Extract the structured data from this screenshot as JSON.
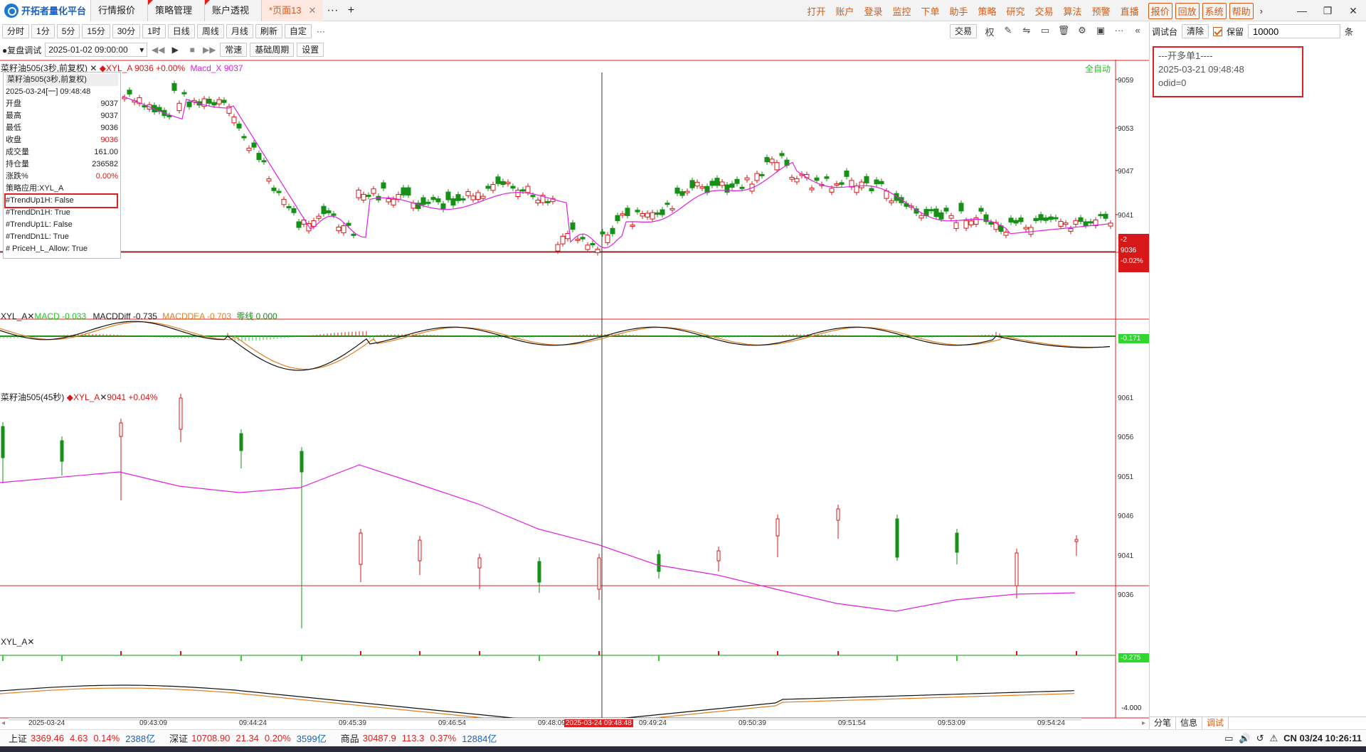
{
  "app": {
    "logo_text": "开拓者量化平台"
  },
  "tabs": [
    {
      "label": "行情报价",
      "flag": false,
      "active": false
    },
    {
      "label": "策略管理",
      "flag": true,
      "active": false
    },
    {
      "label": "账户透视",
      "flag": true,
      "active": false
    },
    {
      "label": "*页面13",
      "flag": false,
      "active": true,
      "close": "✕"
    }
  ],
  "tab_more": "···",
  "tab_add": "+",
  "menu": {
    "items": [
      "打开",
      "账户",
      "登录",
      "监控",
      "下单",
      "助手",
      "策略",
      "研究",
      "交易",
      "算法",
      "预警",
      "直播"
    ],
    "boxed": [
      "报价",
      "回放",
      "系统",
      "帮助"
    ],
    "arrow": "›"
  },
  "window_controls": {
    "minimize": "—",
    "restore": "❐",
    "close": "✕"
  },
  "toolbar1": {
    "periods": [
      "分时",
      "1分",
      "5分",
      "15分",
      "30分",
      "1时",
      "日线",
      "周线",
      "月线",
      "刷新",
      "自定"
    ],
    "more": "···",
    "trade_button": "交易",
    "right_icons": [
      "权",
      "✎",
      "⇋",
      "▭",
      "🗑",
      "⚙",
      "▣",
      "···",
      "«"
    ]
  },
  "toolbar2": {
    "replay_label": "●复盘调试",
    "date_value": "2025-01-02 09:00:00",
    "date_arrow": "▾",
    "controls": [
      "◀◀",
      "▶",
      "■",
      "▶▶"
    ],
    "buttons": [
      "常速",
      "基础周期",
      "设置"
    ]
  },
  "panel1": {
    "title": "菜籽油505(3秒,前复权)",
    "close": "✕",
    "indicator": "◆XYL_A",
    "price": "9036",
    "change": "+0.00%",
    "macd_label": "Macd_X 9037",
    "auto_label": "全自动",
    "price_tag": [
      "-2",
      "9036",
      "-0.02%"
    ],
    "yticks": [
      "9059",
      "9053",
      "9047",
      "9041"
    ]
  },
  "infobox": {
    "title": "菜籽油505(3秒,前复权)",
    "datetime": "2025-03-24[一] 09:48:48",
    "rows": [
      {
        "k": "开盘",
        "v": "9037"
      },
      {
        "k": "最高",
        "v": "9037"
      },
      {
        "k": "最低",
        "v": "9036"
      },
      {
        "k": "收盘",
        "v": "9036"
      },
      {
        "k": "成交量",
        "v": "161.00"
      },
      {
        "k": "持仓量",
        "v": "236582"
      },
      {
        "k": "涨跌%",
        "v": "0.00%"
      }
    ],
    "strategy": "策略应用:XYL_A",
    "flags": [
      "#TrendUp1H: False",
      "#TrendDn1H: True",
      "#TrendUp1L: False",
      "#TrendDn1L: True",
      "# PriceH_L_Allow: True"
    ]
  },
  "panel2": {
    "name": "XYL_A",
    "close": "✕",
    "macd": "MACD -0.033",
    "diff": "MACDDiff -0.735",
    "dea": "MACDDEA -0.703",
    "zero": "零线 0.000",
    "tag": "-0.171"
  },
  "panel3": {
    "title": "菜籽油505(45秒)",
    "indicator": "◆XYL_A",
    "close": "✕",
    "price": "9041",
    "change": "+0.04%",
    "yticks": [
      "9061",
      "9056",
      "9051",
      "9046",
      "9041",
      "9036"
    ]
  },
  "panel4": {
    "name": "XYL_A",
    "close": "✕",
    "tag": "-0.275",
    "ytick": "-4.000"
  },
  "xaxis": {
    "labels": [
      "2025-03-24",
      "09:43:09",
      "09:44:24",
      "09:45:39",
      "09:46:54",
      "09:48:09",
      "09:49:24",
      "09:50:39",
      "09:51:54",
      "09:53:09",
      "09:54:24"
    ],
    "cursor_label": "2025-03-24 09:48:48",
    "arrow_left": "◂",
    "arrow_right": "▸"
  },
  "right_panel": {
    "debug_label": "调试台",
    "clear_button": "清除",
    "keep_label": "保留",
    "keep_value": "10000",
    "edge_label": "条",
    "log": [
      "---开多单1----",
      "2025-03-21 09:48:48",
      "odid=0"
    ],
    "tabs": [
      "分笔",
      "信息",
      "调试"
    ]
  },
  "status": {
    "items": [
      {
        "label": "上证",
        "vals": [
          "3369.46",
          "4.63",
          "0.14%"
        ],
        "amt": "2388亿"
      },
      {
        "label": "深证",
        "vals": [
          "10708.90",
          "21.34",
          "0.20%"
        ],
        "amt": "3599亿"
      },
      {
        "label": "商品",
        "vals": [
          "30487.9",
          "113.3",
          "0.37%"
        ],
        "amt": "12884亿"
      }
    ],
    "clock": "CN 03/24 10:26:11",
    "icons": [
      "▭",
      "🔊",
      "↺",
      "⚠"
    ]
  },
  "colors": {
    "up": "#d81818",
    "down": "#169016",
    "ma": "#e020e0",
    "accent": "#d85b13"
  }
}
